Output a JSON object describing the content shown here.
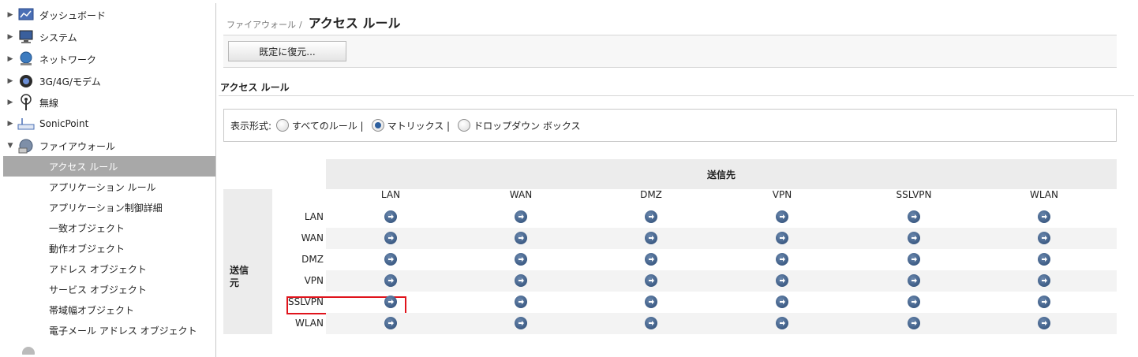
{
  "sidebar": {
    "items": [
      {
        "label": "ダッシュボード",
        "icon": "dashboard-icon",
        "expanded": false
      },
      {
        "label": "システム",
        "icon": "system-monitor-icon",
        "expanded": false
      },
      {
        "label": "ネットワーク",
        "icon": "network-globe-icon",
        "expanded": false
      },
      {
        "label": "3G/4G/モデム",
        "icon": "modem-icon",
        "expanded": false
      },
      {
        "label": "無線",
        "icon": "wireless-antenna-icon",
        "expanded": false
      },
      {
        "label": "SonicPoint",
        "icon": "access-point-icon",
        "expanded": false
      },
      {
        "label": "ファイアウォール",
        "icon": "firewall-icon",
        "expanded": true
      }
    ],
    "firewall_sub": [
      {
        "label": "アクセス ルール",
        "active": true
      },
      {
        "label": "アプリケーション ルール",
        "active": false
      },
      {
        "label": "アプリケーション制御詳細",
        "active": false
      },
      {
        "label": "一致オブジェクト",
        "active": false
      },
      {
        "label": "動作オブジェクト",
        "active": false
      },
      {
        "label": "アドレス オブジェクト",
        "active": false
      },
      {
        "label": "サービス オブジェクト",
        "active": false
      },
      {
        "label": "帯域幅オブジェクト",
        "active": false
      },
      {
        "label": "電子メール アドレス オブジェクト",
        "active": false
      }
    ]
  },
  "breadcrumb": {
    "parent": "ファイアウォール",
    "separator": "/",
    "current": "アクセス ルール"
  },
  "toolbar": {
    "restore_label": "既定に復元..."
  },
  "section": {
    "title": "アクセス ルール"
  },
  "view": {
    "label": "表示形式:",
    "options": [
      {
        "label": "すべてのルール |",
        "checked": false
      },
      {
        "label": "マトリックス |",
        "checked": true
      },
      {
        "label": "ドロップダウン ボックス",
        "checked": false
      }
    ]
  },
  "matrix": {
    "dest_header": "送信先",
    "src_header": "送信元",
    "columns": [
      "LAN",
      "WAN",
      "DMZ",
      "VPN",
      "SSLVPN",
      "WLAN"
    ],
    "rows": [
      "LAN",
      "WAN",
      "DMZ",
      "VPN",
      "SSLVPN",
      "WLAN"
    ],
    "highlighted_row": "SSLVPN",
    "highlighted_col": "LAN"
  },
  "colors": {
    "accent": "#2a4a74",
    "highlight": "#e0141c",
    "active_nav": "#a8a8a8"
  }
}
